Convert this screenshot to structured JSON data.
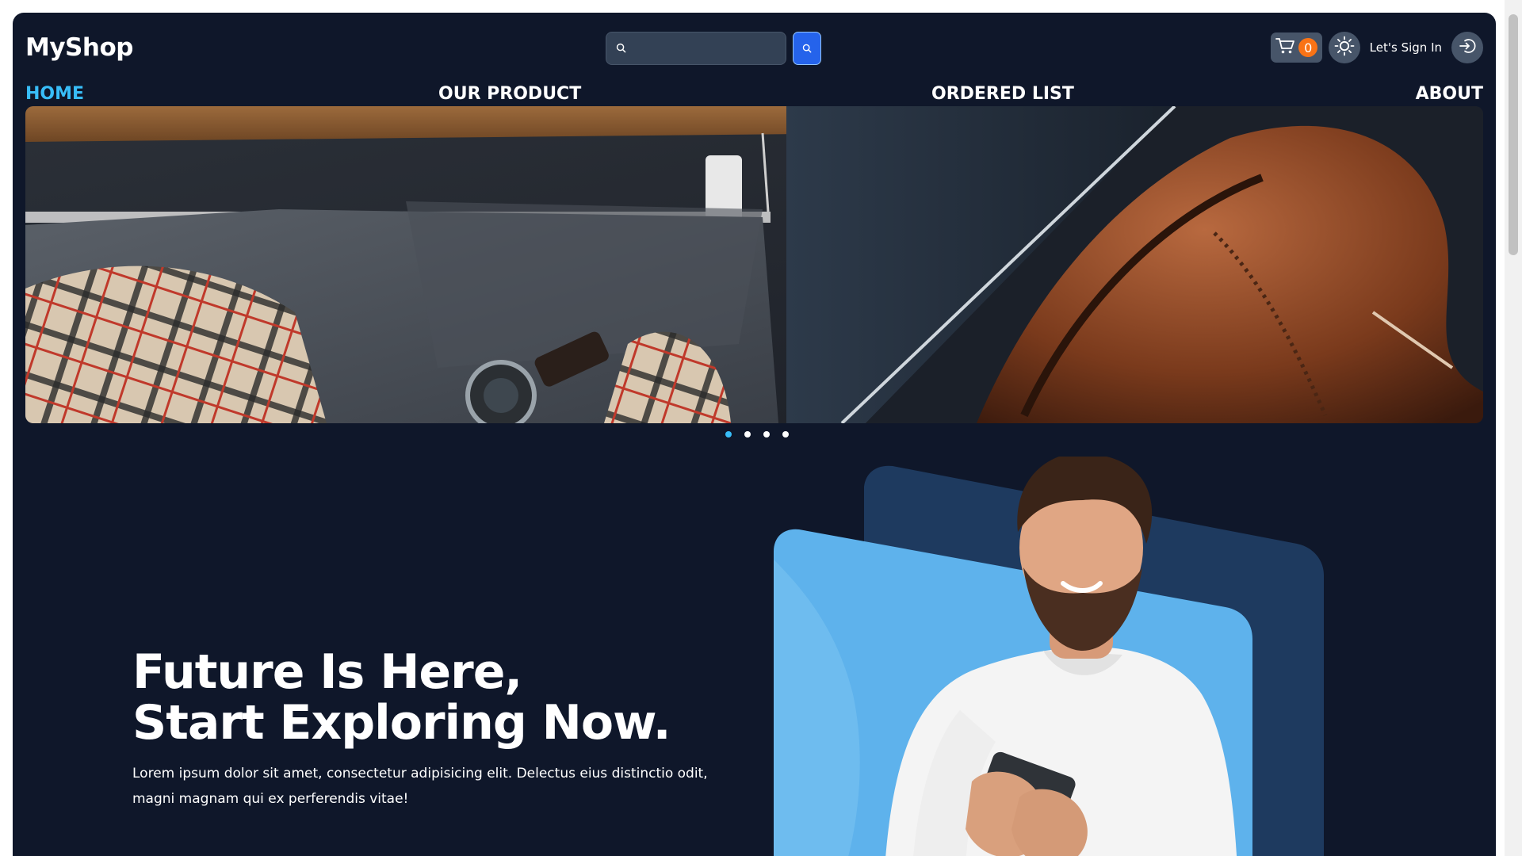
{
  "header": {
    "logo": "MyShop",
    "search": {
      "placeholder": "",
      "value": ""
    },
    "cart": {
      "count": "0"
    },
    "signin_label": "Let's Sign In"
  },
  "nav": {
    "items": [
      {
        "label": "HOME",
        "active": true
      },
      {
        "label": "OUR PRODUCT",
        "active": false
      },
      {
        "label": "ORDERED LIST",
        "active": false
      },
      {
        "label": "ABOUT",
        "active": false
      }
    ]
  },
  "carousel": {
    "slide_count": 4,
    "active_index": 0
  },
  "hero": {
    "title_line1": "Future Is Here,",
    "title_line2": "Start Exploring Now.",
    "text": "Lorem ipsum dolor sit amet, consectetur adipisicing elit. Delectus eius distinctio odit, magni magnam qui ex perferendis vitae!"
  },
  "colors": {
    "background": "#0f172a",
    "accent": "#38bdf8",
    "search_button": "#2563eb",
    "cart_badge": "#f97316"
  },
  "icons": {
    "search": "search-icon",
    "cart": "cart-icon",
    "theme": "sun-icon",
    "signin": "sign-in-icon"
  }
}
